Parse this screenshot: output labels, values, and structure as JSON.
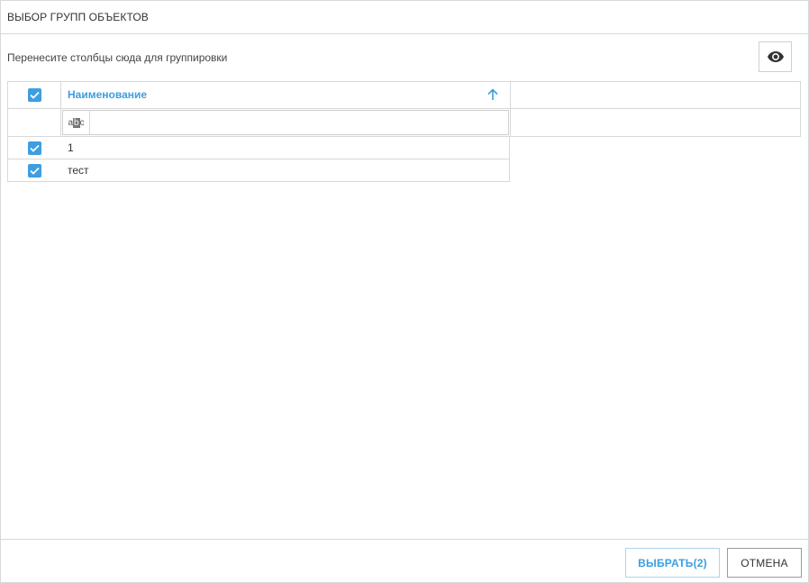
{
  "dialog": {
    "title": "ВЫБОР ГРУПП ОБЪЕКТОВ"
  },
  "grid": {
    "group_hint": "Перенесите столбцы сюда для группировки",
    "column_chooser_icon": "eye-icon",
    "select_all_checked": true,
    "columns": [
      {
        "title": "Наименование",
        "sort": "ascending",
        "sort_icon": "arrow-up-icon"
      }
    ],
    "filter": {
      "type_icon_left": "a",
      "type_icon_mid": "b",
      "type_icon_right": "c",
      "value": ""
    },
    "rows": [
      {
        "name": "1",
        "checked": true
      },
      {
        "name": "тест",
        "checked": true
      }
    ]
  },
  "footer": {
    "select_label": "ВЫБРАТЬ(2)",
    "cancel_label": "ОТМЕНА"
  },
  "colors": {
    "accent": "#3d9ee0",
    "border": "#d8d8d8"
  }
}
